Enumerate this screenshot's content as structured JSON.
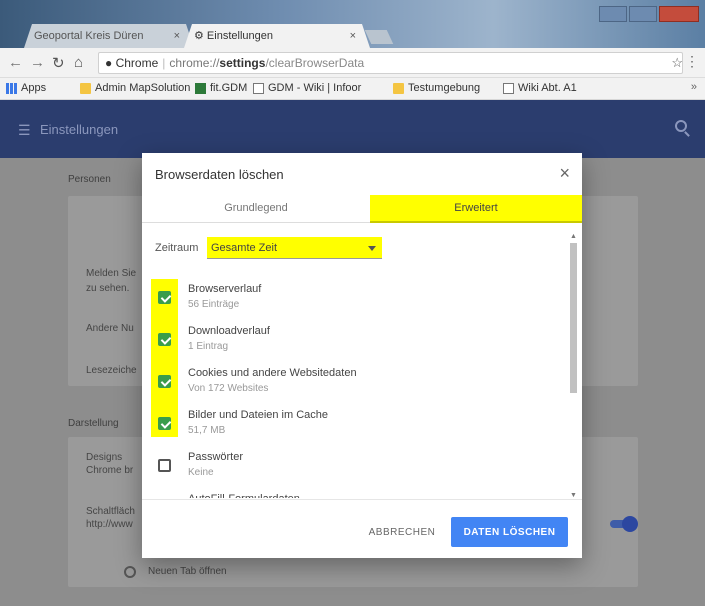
{
  "window": {
    "tabs": [
      {
        "label": "Geoportal Kreis Düren",
        "active": false
      },
      {
        "label": "Einstellungen",
        "active": true
      }
    ]
  },
  "toolbar": {
    "site_label": "Chrome",
    "url_host": "chrome://",
    "url_bold": "settings",
    "url_rest": "/clearBrowserData"
  },
  "bookmarks": [
    {
      "label": "Apps",
      "icon": "apps-icon"
    },
    {
      "label": "Admin MapSolution",
      "icon": "folder-icon"
    },
    {
      "label": "fit.GDM",
      "icon": "grid-icon"
    },
    {
      "label": "GDM - Wiki | Infoor",
      "icon": "doc-icon"
    },
    {
      "label": "Testumgebung",
      "icon": "folder-icon"
    },
    {
      "label": "Wiki Abt. A1",
      "icon": "doc-icon"
    }
  ],
  "settings": {
    "title": "Einstellungen",
    "section_people": "Personen",
    "section_autofill": "Darstellung",
    "bg_items": [
      "Melden Sie",
      "zu sehen.",
      "Andere Nu",
      "Lesezeiche",
      "Designs",
      "Chrome br",
      "Schaltfläch",
      "http://www",
      "Neuen Tab öffnen"
    ]
  },
  "dialog": {
    "title": "Browserdaten löschen",
    "tab_basic": "Grundlegend",
    "tab_advanced": "Erweitert",
    "range_label": "Zeitraum",
    "range_value": "Gesamte Zeit",
    "items": [
      {
        "label": "Browserverlauf",
        "sub": "56 Einträge",
        "checked": true
      },
      {
        "label": "Downloadverlauf",
        "sub": "1 Eintrag",
        "checked": true
      },
      {
        "label": "Cookies und andere Websitedaten",
        "sub": "Von 172 Websites",
        "checked": true
      },
      {
        "label": "Bilder und Dateien im Cache",
        "sub": "51,7 MB",
        "checked": true
      },
      {
        "label": "Passwörter",
        "sub": "Keine",
        "checked": false
      },
      {
        "label": "AutoFill-Formulardaten",
        "sub": "",
        "checked": false
      }
    ],
    "cancel_label": "ABBRECHEN",
    "delete_label": "DATEN LÖSCHEN"
  },
  "colors": {
    "accent": "#4285f4",
    "highlight": "#ffff00",
    "checkbox": "#3a9d4a",
    "header": "#2b3d6e"
  }
}
